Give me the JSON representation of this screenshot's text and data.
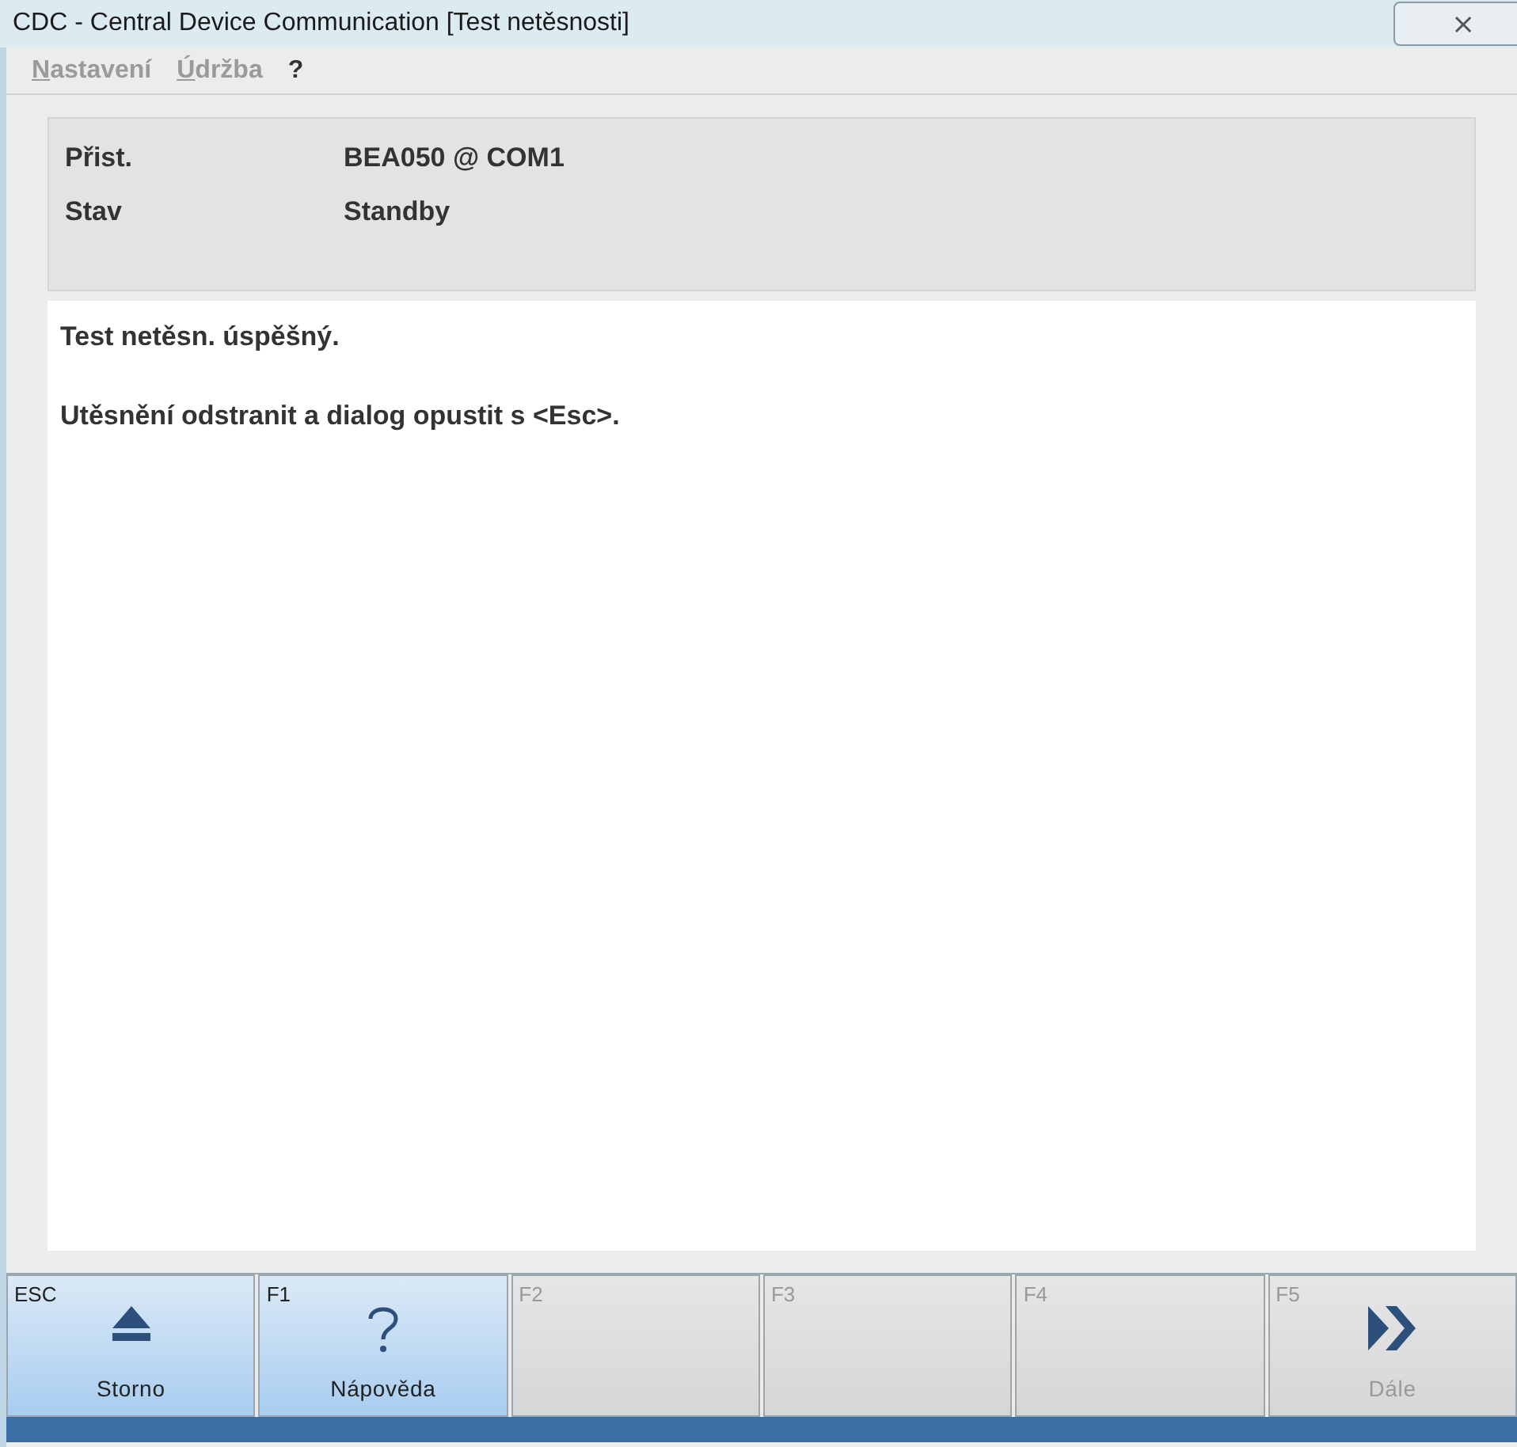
{
  "window": {
    "title": "CDC - Central Device Communication [Test netěsnosti]",
    "close": "⨯"
  },
  "menu": [
    {
      "label": "Nastavení",
      "disabled": true,
      "mnemonic": true
    },
    {
      "label": "Údržba",
      "disabled": true,
      "mnemonic": true
    },
    {
      "label": "?",
      "disabled": false
    }
  ],
  "info": [
    {
      "label": "Přist.",
      "value": "BEA050 @ COM1"
    },
    {
      "label": "Stav",
      "value": "Standby"
    }
  ],
  "messages": [
    "Test netěsn. úspěšný.",
    "Utěsnění odstranit a dialog opustit s <Esc>."
  ],
  "keys": [
    {
      "key": "ESC",
      "label": "Storno",
      "kind": "eject",
      "disabled": false
    },
    {
      "key": "F1",
      "label": "Nápověda",
      "kind": "help",
      "disabled": false
    },
    {
      "key": "F2",
      "disabled": true
    },
    {
      "key": "F3",
      "disabled": true
    },
    {
      "key": "F4",
      "disabled": true
    },
    {
      "key": "F5",
      "label": "Dále",
      "kind": "next",
      "disabled": true
    }
  ]
}
